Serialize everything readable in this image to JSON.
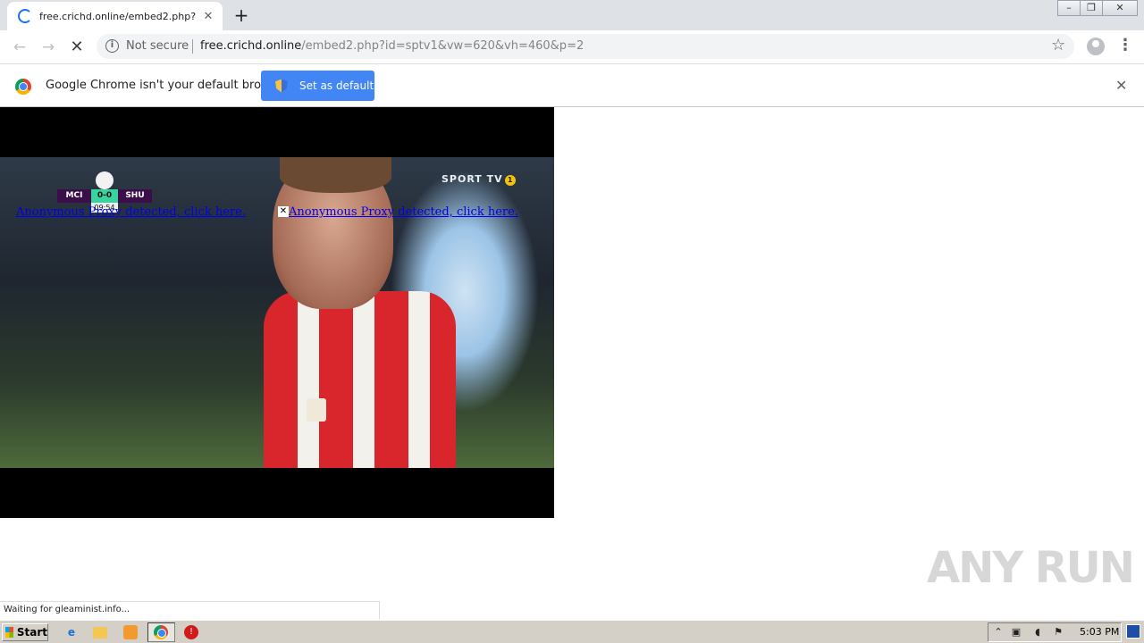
{
  "window": {
    "tab_title": "free.crichd.online/embed2.php?id=sptv1&vw=620&vh=460&p=2",
    "new_tab_symbol": "+",
    "tab_close_symbol": "✕",
    "min_symbol": "–",
    "max_symbol": "❐",
    "close_symbol": "✕"
  },
  "toolbar": {
    "back_symbol": "←",
    "forward_symbol": "→",
    "stop_symbol": "✕",
    "security_label": "Not secure",
    "url_host": "free.crichd.online",
    "url_path": "/embed2.php?id=sptv1&vw=620&vh=460&p=2",
    "bookmark_symbol": "☆",
    "menu_symbol": "⋮"
  },
  "infobar": {
    "message": "Google Chrome isn't your default browser",
    "button_label": "Set as default",
    "close_symbol": "✕"
  },
  "video": {
    "home_team": "MCI",
    "away_team": "SHU",
    "score": "0-0",
    "clock": "09:54",
    "channel": "SPORT TV",
    "channel_number": "1",
    "proxy_link_1": "Anonymous Proxy detected, click here.",
    "proxy_link_2": "Anonymous Proxy detected, click here.",
    "ad_close_symbol": "✕"
  },
  "status_text": "Waiting for gleaminist.info...",
  "watermark": "ANY RUN",
  "taskbar": {
    "start_label": "Start",
    "time": "5:03 PM"
  },
  "colors": {
    "accent": "#4285f4",
    "link": "#0000ee",
    "tab_strip": "#dee1e6"
  }
}
